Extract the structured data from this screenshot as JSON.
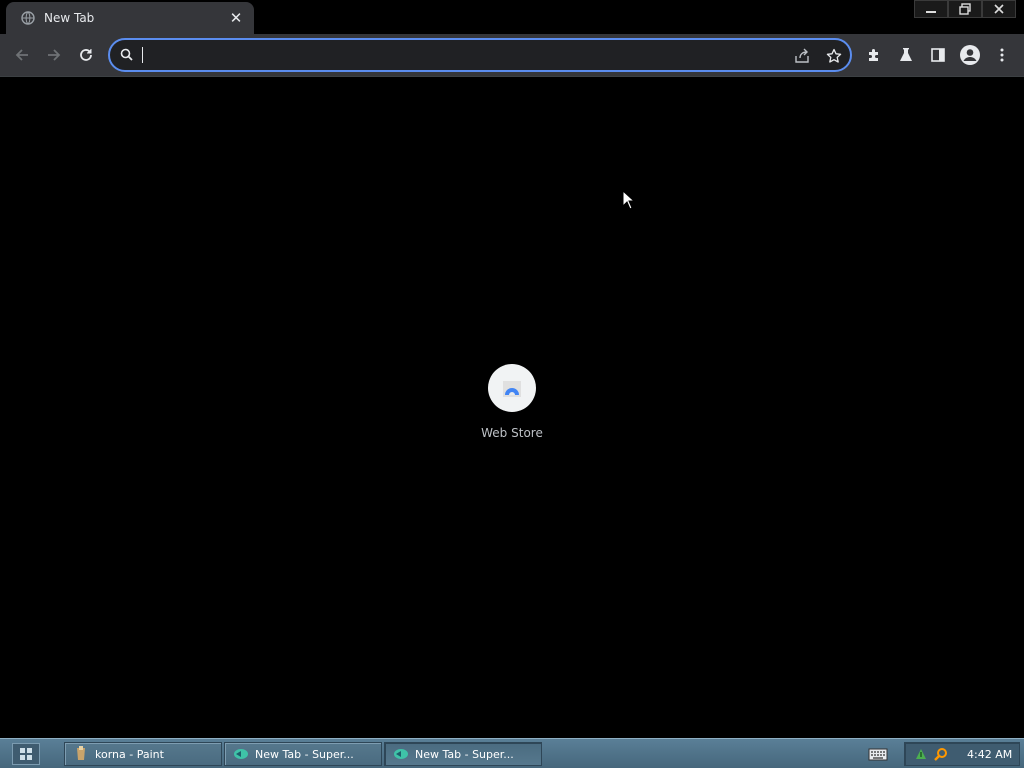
{
  "tab": {
    "title": "New Tab",
    "close_glyph": "✕",
    "favicon": "globe-icon"
  },
  "window_controls": [
    "minimize-icon",
    "restore-icon",
    "close-icon"
  ],
  "toolbar": {
    "back": "back-arrow-icon",
    "forward": "forward-arrow-icon",
    "reload": "reload-icon",
    "omnibox": {
      "value": "",
      "placeholder": ""
    },
    "right_icons": [
      "share-icon",
      "star-icon",
      "extensions-icon",
      "labs-icon",
      "side-panel-icon",
      "profile-icon",
      "menu-icon"
    ]
  },
  "content": {
    "shortcuts": [
      {
        "label": "Web Store",
        "icon": "web-store-icon"
      }
    ]
  },
  "taskbar": {
    "tasks": [
      {
        "label": "korna - Paint",
        "icon": "paint-icon",
        "active": false
      },
      {
        "label": "New Tab - Super...",
        "icon": "browser-icon",
        "active": false
      },
      {
        "label": "New Tab - Super...",
        "icon": "browser-icon",
        "active": true
      }
    ],
    "clock": "4:42 AM"
  },
  "colors": {
    "accent": "#5b8def",
    "toolbar": "#35363a",
    "page_bg": "#000000",
    "taskbar": "#4f7186"
  }
}
